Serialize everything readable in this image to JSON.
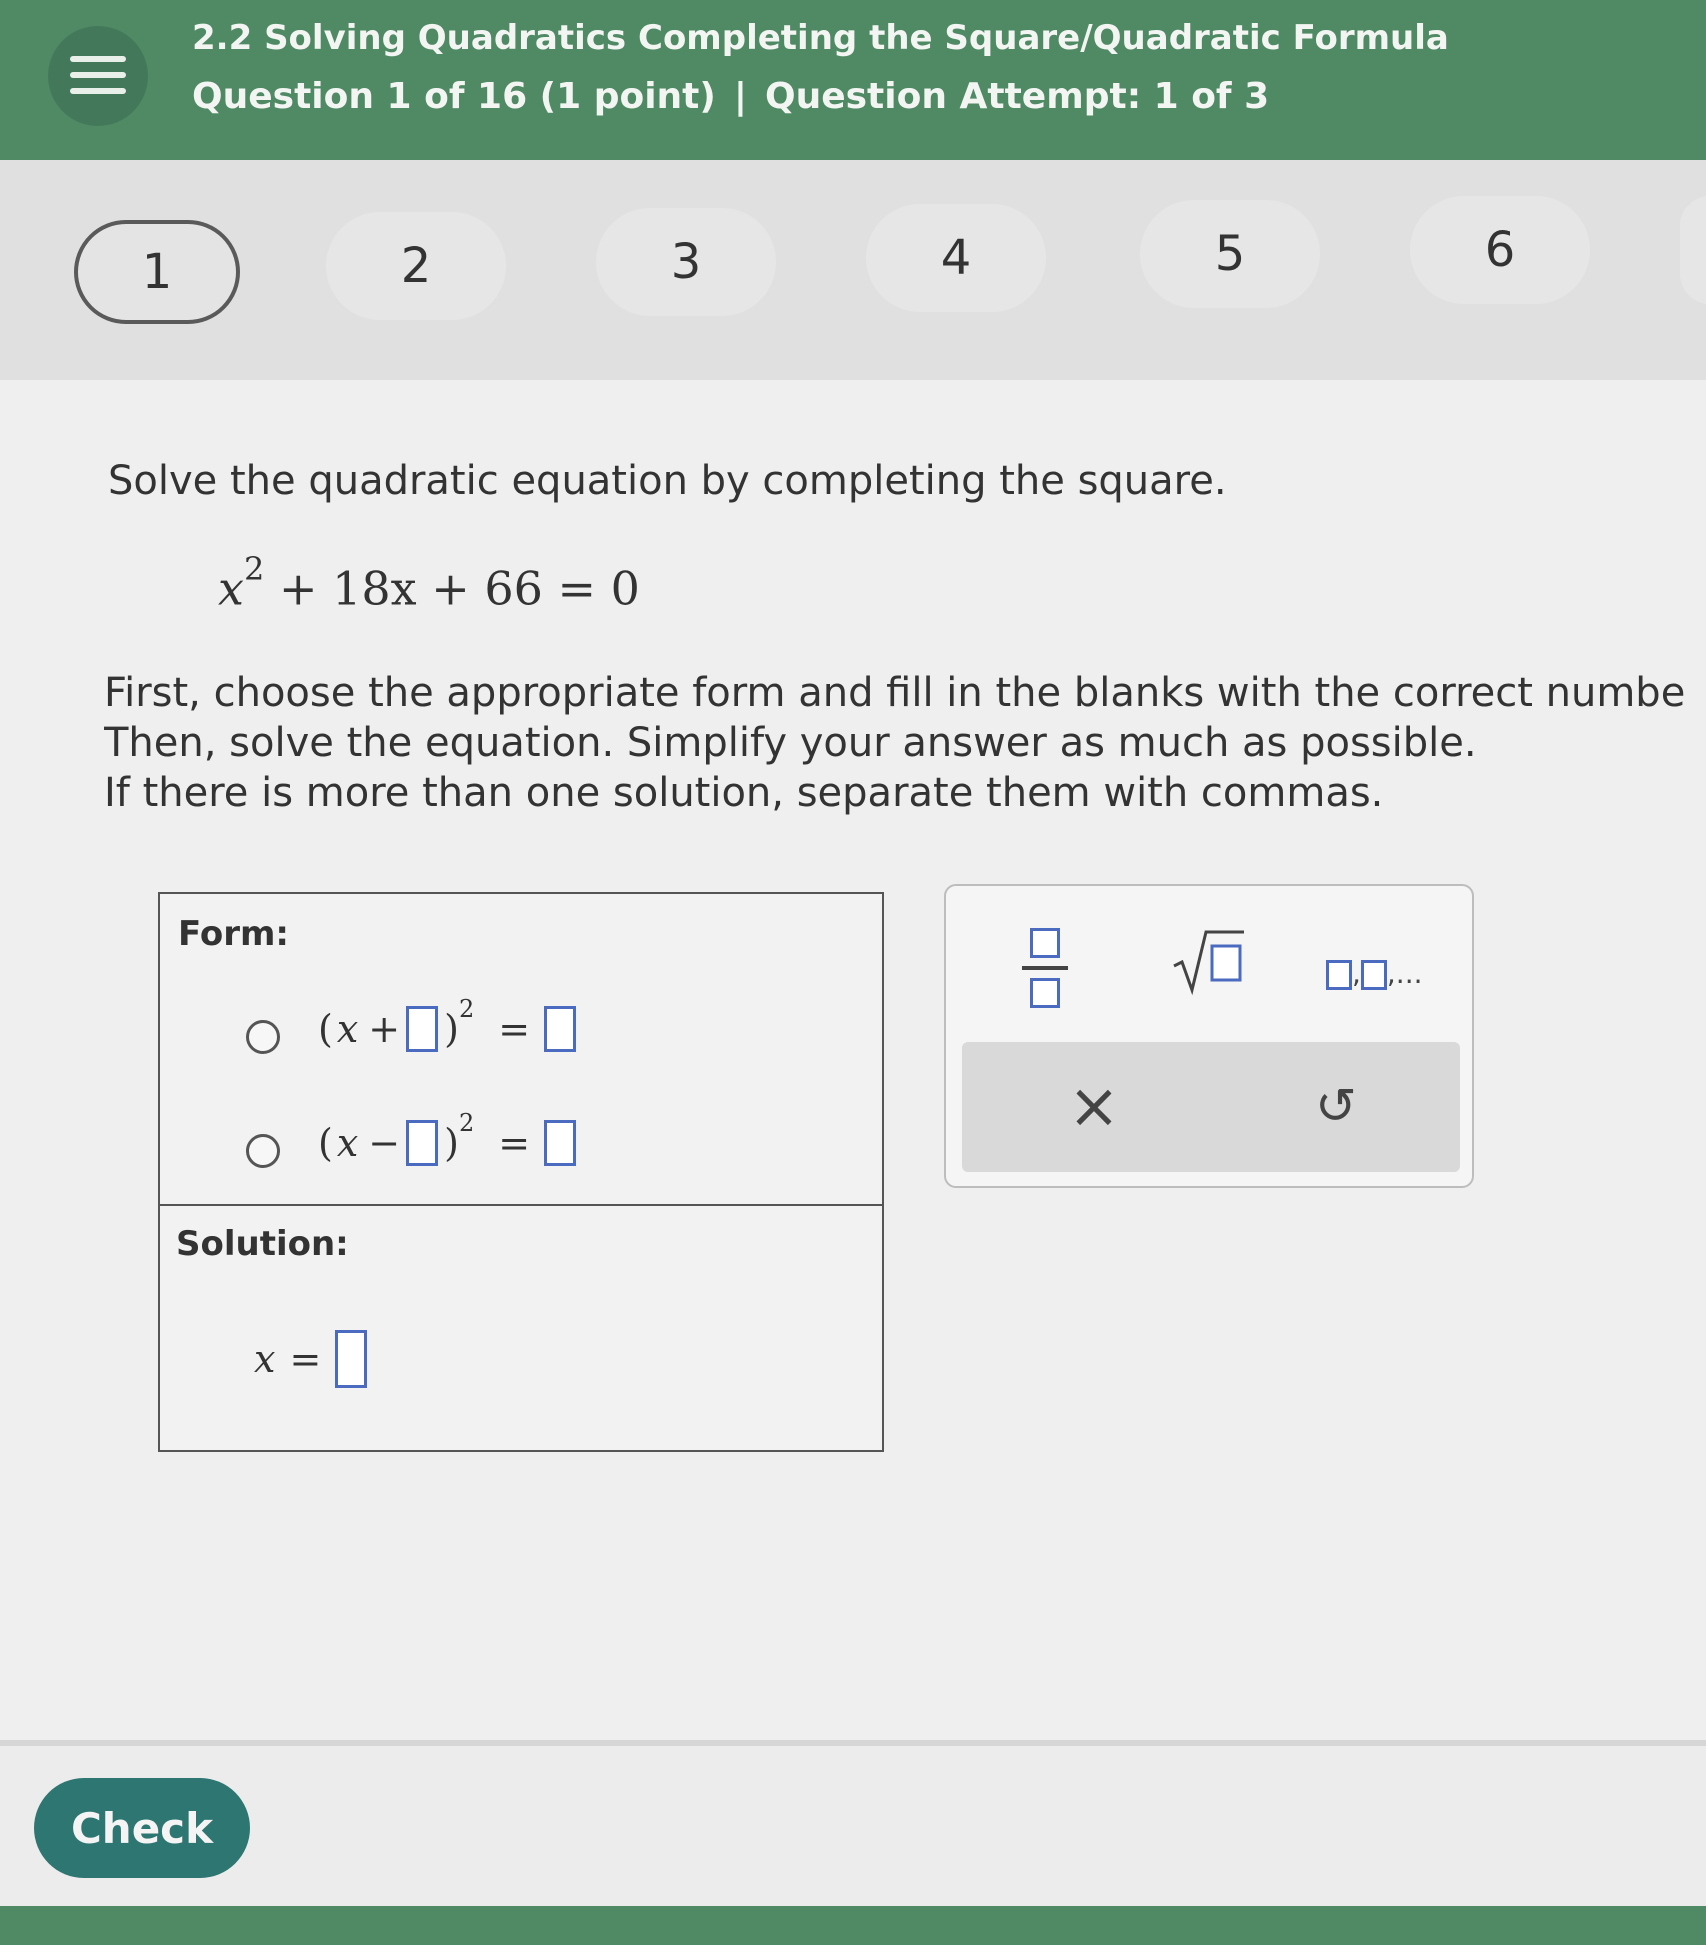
{
  "header": {
    "title": "2.2 Solving Quadratics Completing the Square/Quadratic Formula",
    "question_info": "Question 1 of 16 (1 point)",
    "separator": "|",
    "attempt_info": "Question Attempt: 1 of 3"
  },
  "question_nav": [
    "1",
    "2",
    "3",
    "4",
    "5",
    "6"
  ],
  "problem": {
    "prompt": "Solve the quadratic equation by completing the square.",
    "equation": {
      "base": "x",
      "exponent": "2",
      "rest": "+ 18x + 66 = 0"
    },
    "instructions": [
      "First, choose the appropriate form and fill in the blanks with the correct numbe",
      "Then, solve the equation. Simplify your answer as much as possible.",
      "If there is more than one solution, separate them with commas."
    ]
  },
  "answer": {
    "form_label": "Form:",
    "option1": {
      "open": "(",
      "var": "x",
      "op": "+",
      "close": ")",
      "exp": "2",
      "eq": "="
    },
    "option2": {
      "open": "(",
      "var": "x",
      "op": "−",
      "close": ")",
      "exp": "2",
      "eq": "="
    },
    "solution_label": "Solution:",
    "solution": {
      "var": "x",
      "eq": "="
    }
  },
  "toolbox": {
    "list_suffix": ",...",
    "clear_symbol": "×",
    "undo_symbol": "↺"
  },
  "footer": {
    "check_label": "Check"
  },
  "colors": {
    "header_green": "#4f8a64",
    "check_teal": "#2e7672",
    "blank_blue": "#4a6bbf"
  }
}
